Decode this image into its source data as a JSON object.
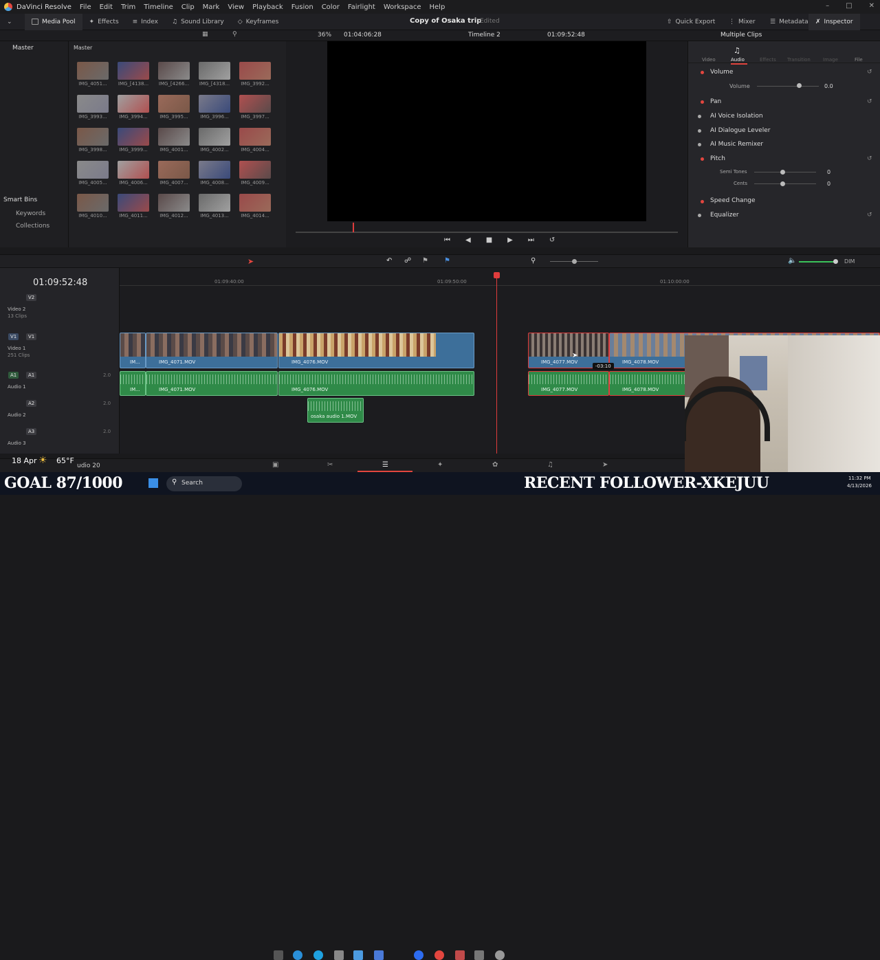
{
  "app": {
    "name": "DaVinci Resolve"
  },
  "menu": [
    "File",
    "Edit",
    "Trim",
    "Timeline",
    "Clip",
    "Mark",
    "View",
    "Playback",
    "Fusion",
    "Color",
    "Fairlight",
    "Workspace",
    "Help"
  ],
  "toolbar": {
    "media_pool": "Media Pool",
    "effects": "Effects",
    "index": "Index",
    "sound_library": "Sound Library",
    "keyframes": "Keyframes",
    "project_title": "Copy of Osaka trip",
    "project_status": "Edited",
    "quick_export": "Quick Export",
    "mixer": "Mixer",
    "metadata": "Metadata",
    "inspector": "Inspector"
  },
  "viewerbar": {
    "zoom": "36%",
    "source_tc": "01:04:06:28",
    "timeline": "Timeline 2",
    "record_tc": "01:09:52:48"
  },
  "leftcol": {
    "master": "Master",
    "smart_bins": "Smart Bins",
    "keywords": "Keywords",
    "collections": "Collections"
  },
  "mediapool": {
    "bin": "Master",
    "clips": [
      "IMG_4051...",
      "IMG_[4138...",
      "IMG_[4266...",
      "IMG_[4318...",
      "IMG_3992...",
      "IMG_3993...",
      "IMG_3994...",
      "IMG_3995...",
      "IMG_3996...",
      "IMG_3997...",
      "IMG_3998...",
      "IMG_3999...",
      "IMG_4001...",
      "IMG_4002...",
      "IMG_4004...",
      "IMG_4005...",
      "IMG_4006...",
      "IMG_4007...",
      "IMG_4008...",
      "IMG_4009...",
      "IMG_4010...",
      "IMG_4011...",
      "IMG_4012...",
      "IMG_4013...",
      "IMG_4014..."
    ]
  },
  "inspector": {
    "title": "Multiple Clips",
    "tabs": [
      "Video",
      "Audio",
      "Effects",
      "Transition",
      "Image",
      "File"
    ],
    "volume_section": "Volume",
    "volume_label": "Volume",
    "volume_value": "0.0",
    "pan": "Pan",
    "ai_voice": "AI Voice Isolation",
    "ai_dialogue": "AI Dialogue Leveler",
    "ai_music": "AI Music Remixer",
    "pitch": "Pitch",
    "semi_tones": "Semi Tones",
    "semi_value": "0",
    "cents": "Cents",
    "cents_value": "0",
    "speed_change": "Speed Change",
    "equalizer": "Equalizer"
  },
  "timeline": {
    "timecode": "01:09:52:48",
    "ruler": [
      "01:09:40:00",
      "01:09:50:00",
      "01:10:00:00"
    ],
    "dim": "DIM",
    "tracks": {
      "v2": {
        "id": "V2",
        "name": "Video 2",
        "count": "13 Clips"
      },
      "v1": {
        "id": "V1",
        "src": "V1",
        "name": "Video 1",
        "count": "251 Clips"
      },
      "a1": {
        "id": "A1",
        "src": "A1",
        "name": "Audio 1",
        "level": "2.0"
      },
      "a2": {
        "id": "A2",
        "name": "Audio 2",
        "level": "2.0"
      },
      "a3": {
        "id": "A3",
        "name": "Audio 3",
        "level": "2.0"
      }
    },
    "clips": {
      "c0": "IM...",
      "c1": "IMG_4071.MOV",
      "c2": "IMG_4076.MOV",
      "c3": "IMG_4077.MOV",
      "c4": "IMG_4078.MOV",
      "a_osaka": "osaka audio 1.MOV",
      "drag_offset": "-03:10"
    }
  },
  "status": {
    "date": "18 Apr",
    "temp": "65°F",
    "audio_label": "udio 20"
  },
  "taskbar": {
    "search": "Search",
    "time": "11:32 PM",
    "date": "4/13/2026"
  },
  "overlay": {
    "goal": "GOAL 87/1000",
    "follower": "RECENT FOLLOWER-XKEJUU"
  },
  "colors": {
    "video_clip": "#3d6f9a",
    "audio_clip": "#2f8a48",
    "playhead": "#e03c3c",
    "accent": "#e3463f"
  }
}
